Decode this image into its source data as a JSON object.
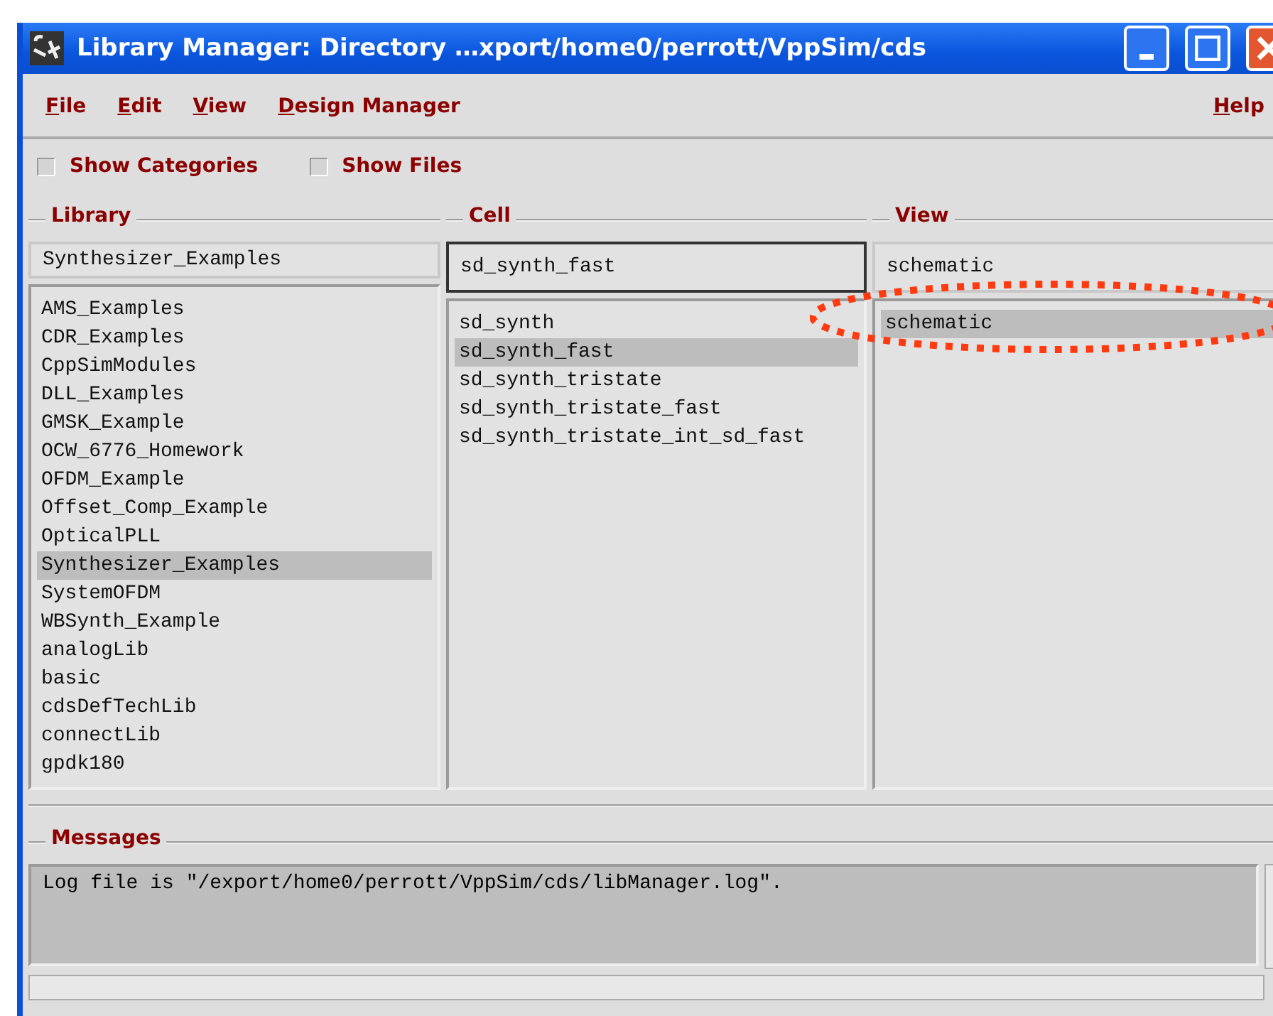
{
  "window": {
    "title": "Library Manager: Directory …xport/home0/perrott/VppSim/cds"
  },
  "menu": [
    "File",
    "Edit",
    "View",
    "Design Manager"
  ],
  "help_menu": "Help",
  "options": [
    {
      "label": "Show Categories",
      "checked": false
    },
    {
      "label": "Show Files",
      "checked": false
    }
  ],
  "columns": [
    {
      "title": "Library",
      "value": "Synthesizer_Examples",
      "focused": false,
      "items": [
        {
          "label": "AMS_Examples",
          "selected": false
        },
        {
          "label": "CDR_Examples",
          "selected": false
        },
        {
          "label": "CppSimModules",
          "selected": false
        },
        {
          "label": "DLL_Examples",
          "selected": false
        },
        {
          "label": "GMSK_Example",
          "selected": false
        },
        {
          "label": "OCW_6776_Homework",
          "selected": false
        },
        {
          "label": "OFDM_Example",
          "selected": false
        },
        {
          "label": "Offset_Comp_Example",
          "selected": false
        },
        {
          "label": "OpticalPLL",
          "selected": false
        },
        {
          "label": "Synthesizer_Examples",
          "selected": true
        },
        {
          "label": "SystemOFDM",
          "selected": false
        },
        {
          "label": "WBSynth_Example",
          "selected": false
        },
        {
          "label": "analogLib",
          "selected": false
        },
        {
          "label": "basic",
          "selected": false
        },
        {
          "label": "cdsDefTechLib",
          "selected": false
        },
        {
          "label": "connectLib",
          "selected": false
        },
        {
          "label": "gpdk180",
          "selected": false
        }
      ]
    },
    {
      "title": "Cell",
      "value": "sd_synth_fast",
      "focused": true,
      "items": [
        {
          "label": "sd_synth",
          "selected": false
        },
        {
          "label": "sd_synth_fast",
          "selected": true
        },
        {
          "label": "sd_synth_tristate",
          "selected": false
        },
        {
          "label": "sd_synth_tristate_fast",
          "selected": false
        },
        {
          "label": "sd_synth_tristate_int_sd_fast",
          "selected": false
        }
      ]
    },
    {
      "title": "View",
      "value": "schematic",
      "focused": false,
      "items": [
        {
          "label": "schematic",
          "selected": true
        }
      ]
    }
  ],
  "messages": {
    "title": "Messages",
    "lines": [
      "Log file is \"/export/home0/perrott/VppSim/cds/libManager.log\"."
    ]
  }
}
